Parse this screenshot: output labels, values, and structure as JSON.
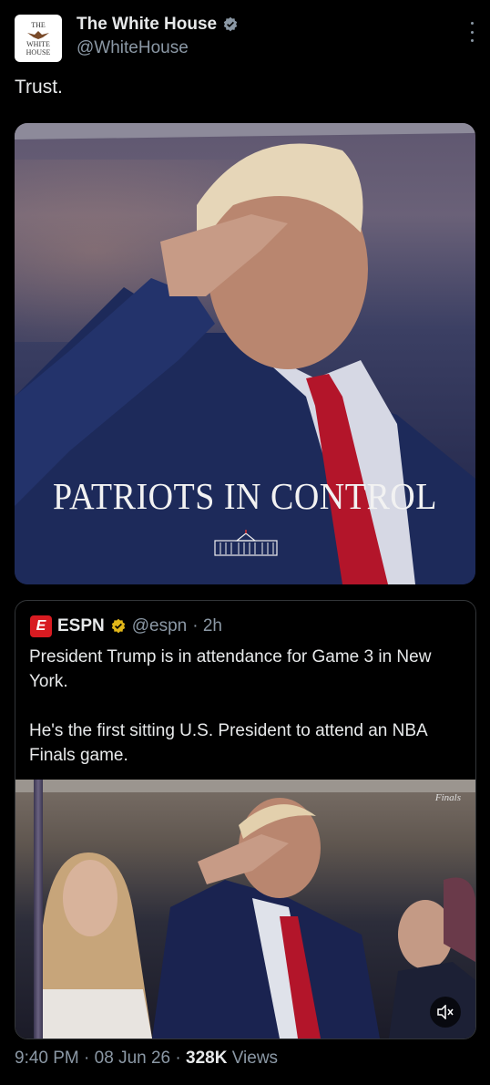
{
  "account": {
    "display_name": "The White House",
    "handle": "@WhiteHouse",
    "avatar_lines": [
      "THE",
      "WHITE",
      "HOUSE"
    ]
  },
  "post": {
    "text": "Trust."
  },
  "media": {
    "headline": "PATRIOTS IN CONTROL"
  },
  "quote": {
    "source_name": "ESPN",
    "source_handle": "@espn",
    "time_ago": "· 2h",
    "logo_letter": "E",
    "text": "President Trump is in attendance for Game 3 in New York.\n\nHe's the first sitting U.S. President to attend an NBA Finals game.",
    "video_watermark": "Finals"
  },
  "footer": {
    "time": "9:40 PM",
    "date": "· 08 Jun 26 ·",
    "views_count": "328K",
    "views_label": "Views"
  },
  "colors": {
    "background": "#000000",
    "text": "#e7e9ea",
    "muted": "#8b98a5",
    "verified_blue": "#8b98a5",
    "verified_gold": "#e2b719",
    "espn_red": "#d81b21"
  }
}
